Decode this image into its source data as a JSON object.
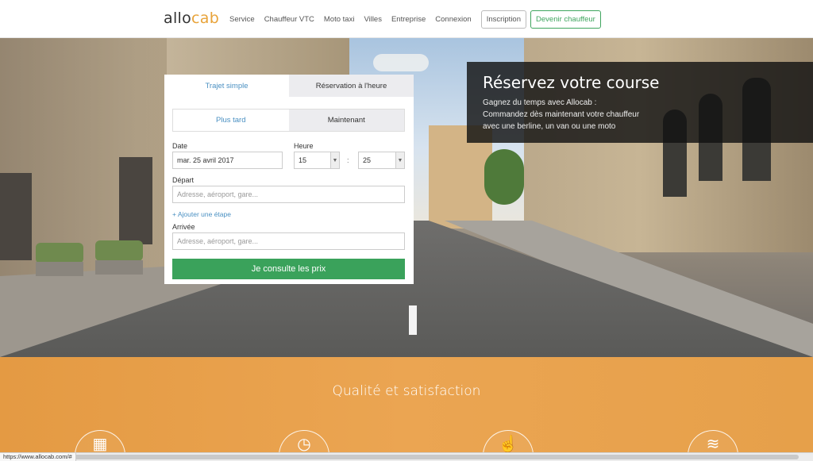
{
  "header": {
    "logo_main": "allo",
    "logo_accent": "cab",
    "nav": [
      "Service",
      "Chauffeur VTC",
      "Moto taxi",
      "Villes",
      "Entreprise",
      "Connexion"
    ],
    "signup_label": "Inscription",
    "driver_label": "Devenir chauffeur"
  },
  "promo": {
    "title": "Réservez votre course",
    "line1": "Gagnez du temps avec Allocab :",
    "line2": "Commandez dès maintenant votre chauffeur",
    "line3": "avec une berline, un van ou une moto"
  },
  "booking": {
    "tabs": [
      "Trajet simple",
      "Réservation à l'heure"
    ],
    "when_options": [
      "Plus tard",
      "Maintenant"
    ],
    "date_label": "Date",
    "date_value": "mar. 25 avril 2017",
    "time_label": "Heure",
    "hour_value": "15",
    "minute_value": "25",
    "time_separator": ":",
    "depart_label": "Départ",
    "depart_placeholder": "Adresse, aéroport, gare...",
    "add_step": "+ Ajouter une étape",
    "arrival_label": "Arrivée",
    "arrival_placeholder": "Adresse, aéroport, gare...",
    "submit_label": "Je consulte les prix"
  },
  "features": {
    "title": "Qualité et satisfaction",
    "icons": [
      "calendar-icon",
      "clock-icon",
      "hand-touch-icon",
      "wifi-icon"
    ]
  },
  "statusbar": {
    "url": "https://www.allocab.com/#"
  },
  "colors": {
    "accent": "#e8a33a",
    "primary_blue": "#4a90c2",
    "cta_green": "#3aa25b",
    "orange_band": "#eba552"
  }
}
